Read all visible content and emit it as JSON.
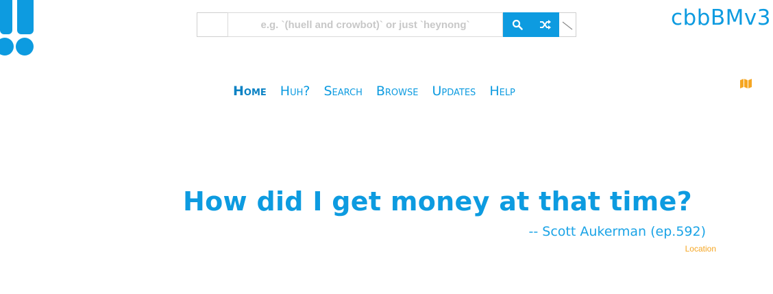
{
  "search": {
    "placeholder": "e.g. `(huell and crowbot)` or just `heynong`",
    "value": "",
    "search_icon": "search-icon",
    "random_icon": "shuffle-icon"
  },
  "site_title": "cbbBMv3",
  "nav": {
    "items": [
      "Home",
      "Huh?",
      "Search",
      "Browse",
      "Updates",
      "Help"
    ],
    "active": "Home",
    "map_icon": "map-icon"
  },
  "quote": {
    "text": "How did I get money at that time?",
    "attribution": "-- Scott Aukerman (ep.592)",
    "location_link": "Location"
  },
  "colors": {
    "accent": "#0d9be0",
    "location": "#f5a623"
  }
}
